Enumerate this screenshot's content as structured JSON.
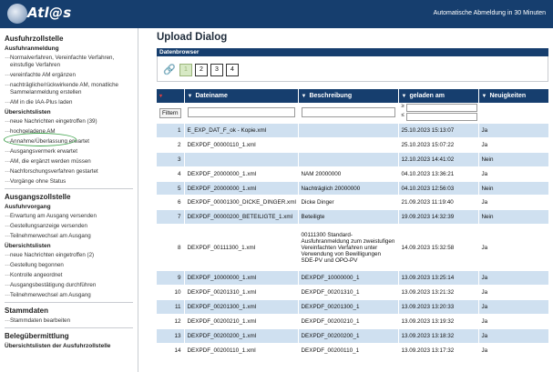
{
  "header": {
    "logo_text": "Atl@s",
    "session_note": "Automatische Abmeldung in 30 Minuten"
  },
  "sidebar": {
    "sections": [
      {
        "title": "Ausfuhrzollstelle",
        "groups": [
          {
            "subtitle": "Ausfuhranmeldung",
            "items": [
              "Normalverfahren, Vereinfachte Verfahren, einstufige Verfahren",
              "vereinfachte AM ergänzen",
              "nachträgliche/rückwirkende AM, monatliche Sammelanmeldung erstellen",
              "AM in die IAA-Plus laden"
            ]
          },
          {
            "subtitle": "Übersichtslisten",
            "items": [
              "neue Nachrichten eingetroffen (39)",
              "hochgeladene AM",
              "Annahme/Überlassung erwartet",
              "Ausgangsvermerk erwartet",
              "AM, die ergänzt werden müssen",
              "Nachforschungsverfahren gestartet",
              "Vorgänge ohne Status"
            ]
          }
        ]
      },
      {
        "title": "Ausgangszollstelle",
        "groups": [
          {
            "subtitle": "Ausfuhrvorgang",
            "items": [
              "Erwartung am Ausgang versenden",
              "Gestellungsanzeige versenden",
              "Teilnehmerwechsel am Ausgang"
            ]
          },
          {
            "subtitle": "Übersichtslisten",
            "items": [
              "neue Nachrichten eingetroffen (2)",
              "Gestellung begonnen",
              "Kontrolle angeordnet",
              "Ausgangsbestätigung durchführen",
              "Teilnehmerwechsel am Ausgang"
            ]
          }
        ]
      },
      {
        "title": "Stammdaten",
        "groups": [
          {
            "subtitle": "",
            "items": [
              "Stammdaten bearbeiten"
            ]
          }
        ]
      },
      {
        "title": "Belegübermittlung",
        "groups": [
          {
            "subtitle": "Übersichtslisten der Ausfuhrzollstelle",
            "items": []
          }
        ]
      }
    ]
  },
  "main": {
    "title": "Upload Dialog",
    "subbar": "Datenbrowser",
    "pages": [
      "1",
      "2",
      "3",
      "4"
    ],
    "active_page": "1",
    "columns": [
      "Dateiname",
      "Beschreibung",
      "geladen am",
      "Neuigkeiten"
    ],
    "filter_label": "Filtern",
    "date_ops": [
      "≥",
      "≤"
    ],
    "rows": [
      {
        "n": "1",
        "file": "E_EXP_DAT_F_ok - Kopie.xml",
        "desc": "",
        "date": "25.10.2023 15:13:07",
        "news": "Ja"
      },
      {
        "n": "2",
        "file": "DEXPDF_00000110_1.xml",
        "desc": "",
        "date": "25.10.2023 15:07:22",
        "news": "Ja"
      },
      {
        "n": "3",
        "file": "",
        "desc": "",
        "date": "12.10.2023 14:41:02",
        "news": "Nein"
      },
      {
        "n": "4",
        "file": "DEXPDF_20000000_1.xml",
        "desc": "NAM 20000000",
        "date": "04.10.2023 13:36:21",
        "news": "Ja"
      },
      {
        "n": "5",
        "file": "DEXPDF_20000000_1.xml",
        "desc": "Nachträglich 20000000",
        "date": "04.10.2023 12:56:03",
        "news": "Nein"
      },
      {
        "n": "6",
        "file": "DEXPDF_00001300_DICKE_DINGER.xml",
        "desc": "Dicke Dinger",
        "date": "21.09.2023 11:19:40",
        "news": "Ja"
      },
      {
        "n": "7",
        "file": "DEXPDF_00000200_BETEILIGTE_1.xml",
        "desc": "Beteiligte",
        "date": "19.09.2023 14:32:39",
        "news": "Nein"
      },
      {
        "n": "8",
        "file": "DEXPDF_00111300_1.xml",
        "desc": "00111300 Standard-Ausfuhranmeldung zum zweistufigen Vereinfachten Verfahren unter Verwendung von Bewilligungen SDE-PV und OPO-PV",
        "date": "14.09.2023 15:32:58",
        "news": "Ja"
      },
      {
        "n": "9",
        "file": "DEXPDF_10000000_1.xml",
        "desc": "DEXPDF_10000000_1",
        "date": "13.09.2023 13:25:14",
        "news": "Ja"
      },
      {
        "n": "10",
        "file": "DEXPDF_00201310_1.xml",
        "desc": "DEXPDF_00201310_1",
        "date": "13.09.2023 13:21:32",
        "news": "Ja"
      },
      {
        "n": "11",
        "file": "DEXPDF_00201300_1.xml",
        "desc": "DEXPDF_00201300_1",
        "date": "13.09.2023 13:20:33",
        "news": "Ja"
      },
      {
        "n": "12",
        "file": "DEXPDF_00200210_1.xml",
        "desc": "DEXPDF_00200210_1",
        "date": "13.09.2023 13:19:32",
        "news": "Ja"
      },
      {
        "n": "13",
        "file": "DEXPDF_00200200_1.xml",
        "desc": "DEXPDF_00200200_1",
        "date": "13.09.2023 13:18:32",
        "news": "Ja"
      },
      {
        "n": "14",
        "file": "DEXPDF_00200110_1.xml",
        "desc": "DEXPDF_00200110_1",
        "date": "13.09.2023 13:17:32",
        "news": "Ja"
      }
    ]
  },
  "colors": {
    "header_bg": "#163e6e",
    "row_alt": "#cfe0f0",
    "highlight_ring": "#3fa34d",
    "active_page": "#d7e9c4"
  }
}
